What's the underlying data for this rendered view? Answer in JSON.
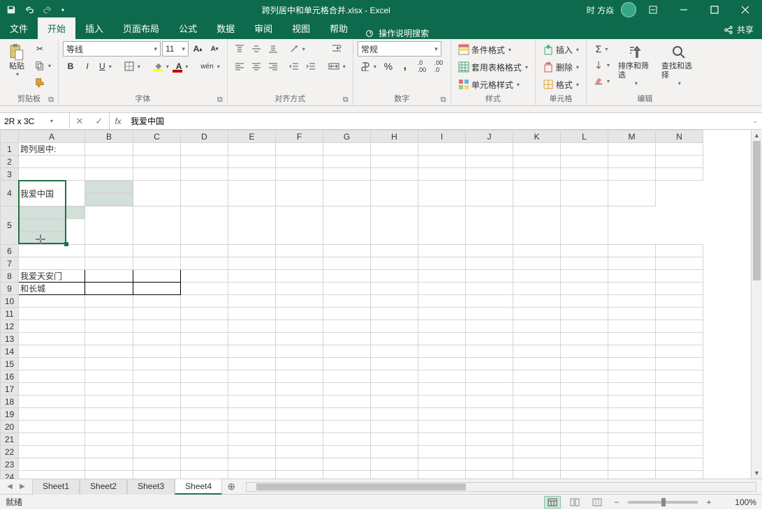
{
  "title": "跨列居中和单元格合并.xlsx  -  Excel",
  "account": "时 方焱",
  "tabs": [
    "文件",
    "开始",
    "插入",
    "页面布局",
    "公式",
    "数据",
    "审阅",
    "视图",
    "帮助"
  ],
  "active_tab": 1,
  "tellme": "操作说明搜索",
  "share": "共享",
  "ribbon": {
    "clipboard": {
      "label": "剪贴板",
      "paste": "粘贴"
    },
    "font": {
      "label": "字体",
      "name": "等线",
      "size": "11"
    },
    "alignment": {
      "label": "对齐方式"
    },
    "number": {
      "label": "数字",
      "format": "常规"
    },
    "styles": {
      "label": "样式",
      "cond": "条件格式",
      "table": "套用表格格式",
      "cell": "单元格样式"
    },
    "cells": {
      "label": "单元格",
      "insert": "插入",
      "delete": "删除",
      "format": "格式"
    },
    "editing": {
      "label": "编辑",
      "sort": "排序和筛选",
      "find": "查找和选择"
    }
  },
  "namebox": "2R x 3C",
  "formula": "我爱中国",
  "columns": [
    "A",
    "B",
    "C",
    "D",
    "E",
    "F",
    "G",
    "H",
    "I",
    "J",
    "K",
    "L",
    "M",
    "N"
  ],
  "rows": 25,
  "cells": {
    "A1": "跨列居中:",
    "A4": "我爱中国",
    "A8": "我爱天安门",
    "A9": "和长城"
  },
  "bordered": [
    "A8",
    "B8",
    "C8",
    "A9",
    "B9",
    "C9"
  ],
  "selection": {
    "r1": 4,
    "c1": 1,
    "r2": 5,
    "c2": 3
  },
  "sheets": [
    "Sheet1",
    "Sheet2",
    "Sheet3",
    "Sheet4"
  ],
  "active_sheet": 3,
  "status": {
    "ready": "就绪",
    "zoom": "100%"
  }
}
